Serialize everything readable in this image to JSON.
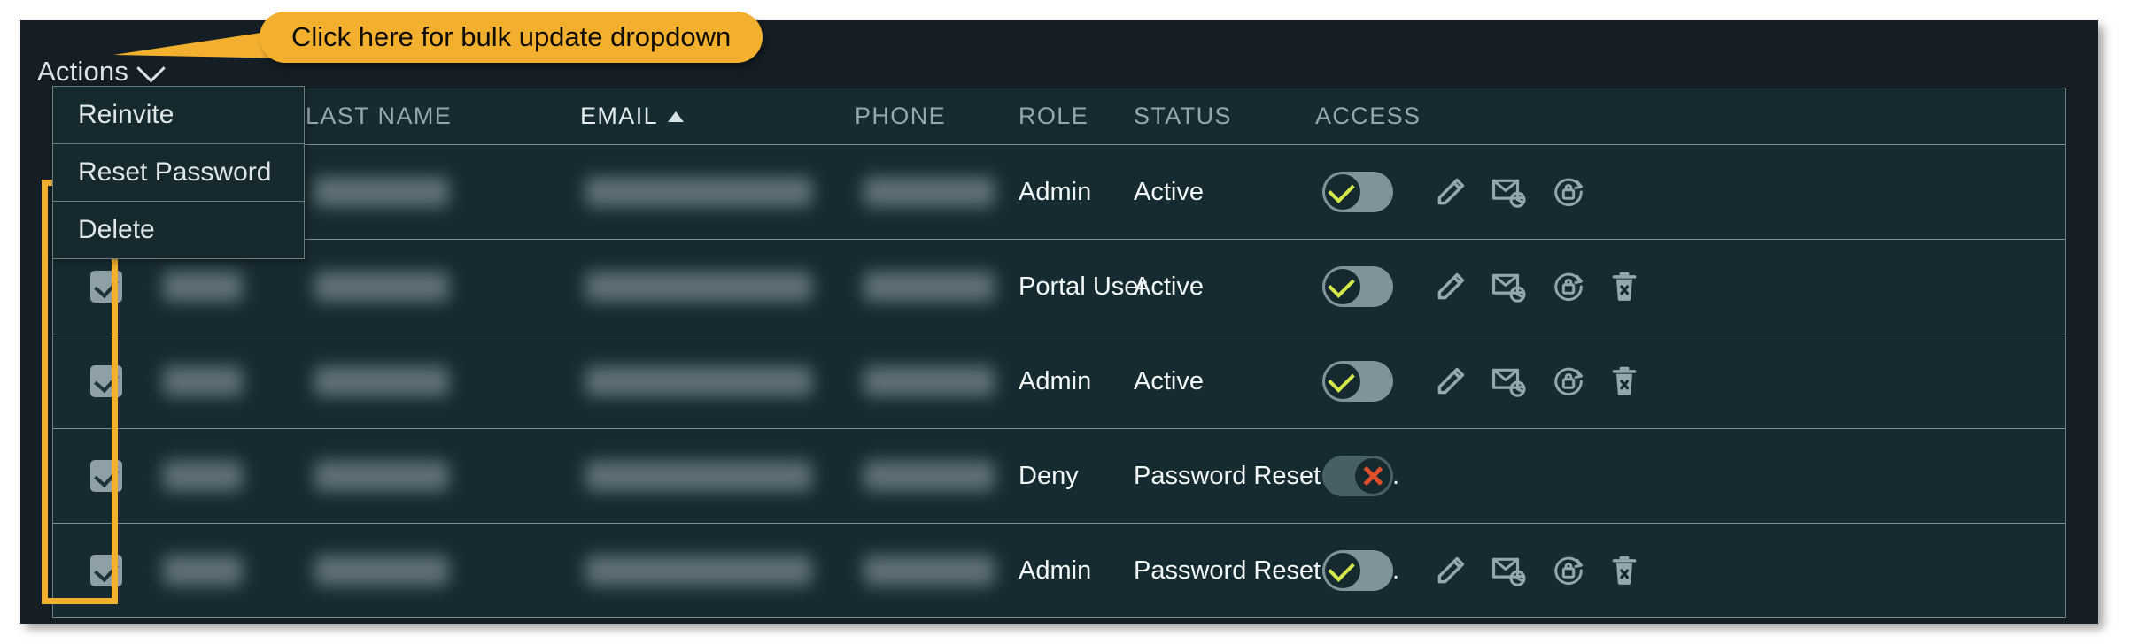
{
  "toolbar": {
    "actions_label": "Actions",
    "chevron_icon": "chevron-down-icon"
  },
  "callout": {
    "text": "Click here for bulk update dropdown",
    "bg_color": "#f2b02e",
    "text_color": "#100d06"
  },
  "dropdown": {
    "items": [
      {
        "label": "Reinvite"
      },
      {
        "label": "Reset Password"
      },
      {
        "label": "Delete"
      }
    ]
  },
  "table": {
    "headers": [
      {
        "label": "",
        "key": "check"
      },
      {
        "label": "",
        "key": "first"
      },
      {
        "label": "LAST NAME",
        "key": "last",
        "sorted": false
      },
      {
        "label": "EMAIL",
        "key": "email",
        "sorted": true,
        "sort_dir": "asc"
      },
      {
        "label": "PHONE",
        "key": "phone",
        "sorted": false
      },
      {
        "label": "ROLE",
        "key": "role",
        "sorted": false
      },
      {
        "label": "STATUS",
        "key": "status",
        "sorted": false
      },
      {
        "label": "ACCESS",
        "key": "access",
        "sorted": false
      }
    ],
    "rows": [
      {
        "checked": false,
        "first_name": "",
        "last_name": "",
        "email": "",
        "phone": "",
        "role": "Admin",
        "status": "Active",
        "access_on": true,
        "icons": [
          "edit-pencil-icon",
          "reinvite-envelope-icon",
          "reset-password-lock-icon"
        ]
      },
      {
        "checked": true,
        "first_name": "",
        "last_name": "",
        "email": "",
        "phone": "",
        "role": "Portal User",
        "status": "Active",
        "access_on": true,
        "icons": [
          "edit-pencil-icon",
          "reinvite-envelope-icon",
          "reset-password-lock-icon",
          "delete-trash-icon"
        ]
      },
      {
        "checked": true,
        "first_name": "",
        "last_name": "",
        "email": "",
        "phone": "",
        "role": "Admin",
        "status": "Active",
        "access_on": true,
        "icons": [
          "edit-pencil-icon",
          "reinvite-envelope-icon",
          "reset-password-lock-icon",
          "delete-trash-icon"
        ]
      },
      {
        "checked": true,
        "first_name": "",
        "last_name": "",
        "email": "",
        "phone": "",
        "role": "Deny",
        "status": "Password Reset Req…",
        "access_on": false,
        "icons": []
      },
      {
        "checked": true,
        "first_name": "",
        "last_name": "",
        "email": "",
        "phone": "",
        "role": "Admin",
        "status": "Password Reset Req…",
        "access_on": true,
        "icons": [
          "edit-pencil-icon",
          "reinvite-envelope-icon",
          "reset-password-lock-icon",
          "delete-trash-icon"
        ]
      }
    ]
  },
  "highlight": {
    "color": "#f2b02e",
    "target": "checkbox-column"
  },
  "colors": {
    "page_bg": "#141e24",
    "table_bg": "#162b31",
    "border": "#7d8f94",
    "header_text": "#93a7ac",
    "body_text": "#f2f6f7",
    "accent_yellow": "#f2b02e",
    "toggle_on_check": "#d4e84a",
    "toggle_off_cross": "#e04f2a"
  }
}
